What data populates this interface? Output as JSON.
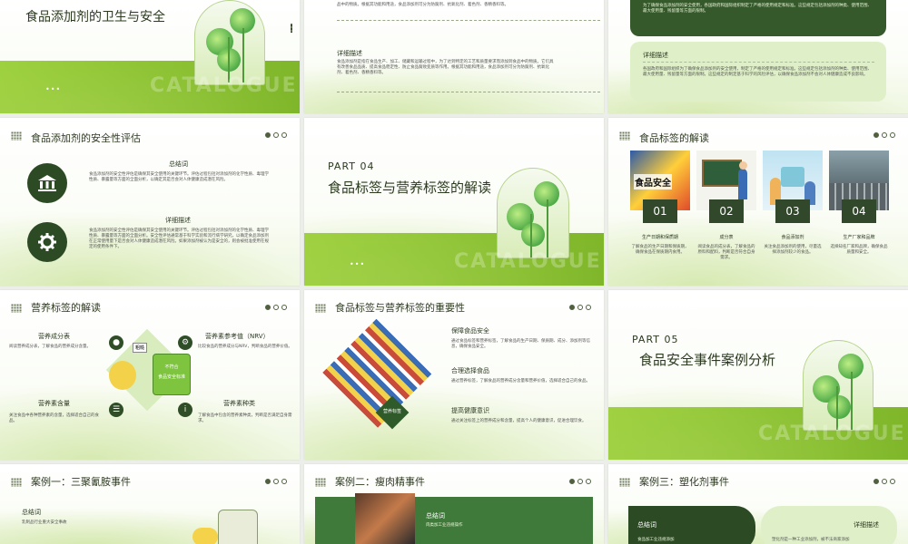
{
  "slide1": {
    "title": "食品添加剂的卫生与安全",
    "more": "•••",
    "watermark": "CATALOGUE"
  },
  "slide2": {
    "top_text": "品中的物质。根据其功能和用途，食品添加剂可分为防腐剂、抗氧化剂、着色剂、香精香料等。",
    "heading": "详细描述",
    "body": "食品添加剂是指在食品生产、加工、储藏和运输过程中，为了达到特定的工艺和质量要求而添加到食品中的物质。它们具有改善食品品质、提高食品稳定性、防止食品腐败变质等作用。根据其功能和用途，食品添加剂可分为防腐剂、抗氧化剂、着色剂、香精香料等。"
  },
  "slide3": {
    "top_text": "为了确保食品添加剂的安全使用，各国政府和国际组织制定了严格的使用规定和标准。这些规定包括添加剂的种类、使用范围、最大使用量、残留量等方面的限制。",
    "heading": "详细描述",
    "body": "各国政府和国际组织为了确保食品添加剂的安全使用，制定了严格的使用规定和标准。这些规定包括添加剂的种类、使用范围、最大使用量、残留量等方面的限制。这些规定的制定基于科学的风险评估，以确保食品添加剂不会对人体健康造成不良影响。"
  },
  "slide4": {
    "title": "食品添加剂的安全性评估",
    "h1": "总结词",
    "p1": "食品添加剂的安全性评估是确保其安全使用的关键环节。评估过程包括对添加剂的化学性质、毒理学性质、暴露量等方面的全面分析，以确定其是否会对人体健康造成潜在风险。",
    "h2": "详细描述",
    "p2": "食品添加剂的安全性评估是确保其安全使用的关键环节。评估过程包括对添加剂的化学性质、毒理学性质、暴露量等方面的全面分析。安全性评估通常基于科学实验和流行病学研究，以确定食品添加剂在正常使用量下是否会对人体健康造成潜在风险。如果添加剂被认为是安全的，则会被批准使用在规定的使用条件下。"
  },
  "slide5": {
    "part": "PART  04",
    "title": "食品标签与营养标签的解读",
    "more": "•••",
    "watermark": "CATALOGUE"
  },
  "slide6": {
    "title": "食品标签的解读",
    "items": [
      {
        "num": "01",
        "label": "生产日期和保质期",
        "desc": "了解食品的生产日期和保质期，确保食品在保质期内食用。"
      },
      {
        "num": "02",
        "label": "成分表",
        "desc": "阅读食品的成分表，了解食品的原料和配料，判断是否符合自身需求。"
      },
      {
        "num": "03",
        "label": "食品添加剂",
        "desc": "关注食品添加剂的使用，尽量选择添加剂较少的食品。"
      },
      {
        "num": "04",
        "label": "生产厂家和品牌",
        "desc": "选择知名厂家和品牌，确保食品质量和安全。"
      }
    ],
    "photo_text": "食品安全"
  },
  "slide7": {
    "title": "营养标签的解读",
    "items": [
      {
        "label": "营养成分表",
        "desc": "阅读营养成分表，了解食品的营养成分含量。"
      },
      {
        "label": "营养素参考值（NRV）",
        "desc": "比较食品的营养成分与NRV，判断食品的营养价值。"
      },
      {
        "label": "营养素含量",
        "desc": "关注食品中各种营养素的含量，选择适合自己的食品。"
      },
      {
        "label": "营养素种类",
        "desc": "了解食品中包含的营养素种类，判断是否满足自身需求。"
      }
    ],
    "sign1": "不符合",
    "sign2": "食品安全标准",
    "board": "粗糙"
  },
  "slide8": {
    "title": "食品标签与营养标签的重要性",
    "badge": "营养标签",
    "items": [
      {
        "label": "保障食品安全",
        "desc": "通过食品标签和营养标签，了解食品的生产日期、保质期、成分、添加剂等信息，确保食品安全。"
      },
      {
        "label": "合理选择食品",
        "desc": "通过营养标签，了解食品的营养成分含量和营养价值，选择适合自己的食品。"
      },
      {
        "label": "提高健康意识",
        "desc": "通过关注标签上的营养成分和含量，提高个人的健康意识，促进合理饮食。"
      }
    ]
  },
  "slide9": {
    "part": "PART  05",
    "title": "食品安全事件案例分析",
    "watermark": "CATALOGUE"
  },
  "slide10": {
    "title": "案例一：三聚氰胺事件",
    "h1": "总结词",
    "p1": "乳制品行业重大安全事故"
  },
  "slide11": {
    "title": "案例二：瘦肉精事件",
    "h1": "总结词",
    "p1": "肉类加工业违规操作"
  },
  "slide12": {
    "title": "案例三：塑化剂事件",
    "h1": "总结词",
    "h2": "详细描述",
    "p1": "食品加工业违规添加",
    "p2": "塑化剂是一种工业添加剂，被不法商家添加"
  },
  "colors": {
    "accent_green": "#8cc63f",
    "dark_green": "#2c4a24"
  }
}
